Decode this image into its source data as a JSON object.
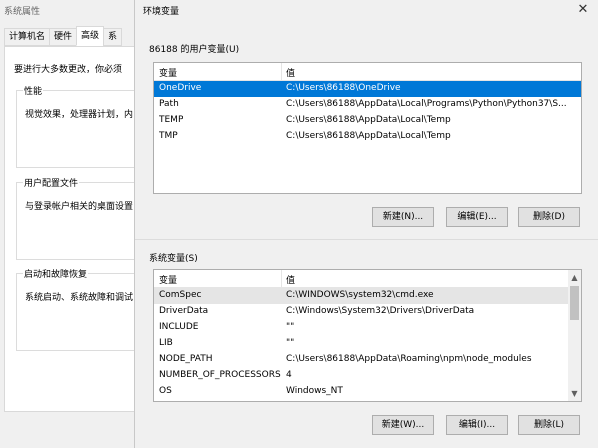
{
  "background_window": {
    "title": "系统属性",
    "tabs": [
      "计算机名",
      "硬件",
      "高级",
      "系"
    ],
    "notice": "要进行大多数更改，你必须",
    "groups": [
      {
        "label": "性能",
        "text": "视觉效果，处理器计划，内"
      },
      {
        "label": "用户配置文件",
        "text": "与登录帐户相关的桌面设置"
      },
      {
        "label": "启动和故障恢复",
        "text": "系统启动、系统故障和调试"
      }
    ]
  },
  "dialog": {
    "title": "环境变量",
    "close_symbol": "✕",
    "user_section_label": "86188 的用户变量(U)",
    "system_section_label": "系统变量(S)",
    "col_variable": "变量",
    "col_value": "值",
    "user_vars": [
      {
        "name": "OneDrive",
        "value": "C:\\Users\\86188\\OneDrive"
      },
      {
        "name": "Path",
        "value": "C:\\Users\\86188\\AppData\\Local\\Programs\\Python\\Python37\\S..."
      },
      {
        "name": "TEMP",
        "value": "C:\\Users\\86188\\AppData\\Local\\Temp"
      },
      {
        "name": "TMP",
        "value": "C:\\Users\\86188\\AppData\\Local\\Temp"
      }
    ],
    "system_vars": [
      {
        "name": "ComSpec",
        "value": "C:\\WINDOWS\\system32\\cmd.exe"
      },
      {
        "name": "DriverData",
        "value": "C:\\Windows\\System32\\Drivers\\DriverData"
      },
      {
        "name": "INCLUDE",
        "value": "\"\""
      },
      {
        "name": "LIB",
        "value": "\"\""
      },
      {
        "name": "NODE_PATH",
        "value": "C:\\Users\\86188\\AppData\\Roaming\\npm\\node_modules"
      },
      {
        "name": "NUMBER_OF_PROCESSORS",
        "value": "4"
      },
      {
        "name": "OS",
        "value": "Windows_NT"
      }
    ],
    "user_buttons": {
      "new": "新建(N)...",
      "edit": "编辑(E)...",
      "delete": "删除(D)"
    },
    "system_buttons": {
      "new": "新建(W)...",
      "edit": "编辑(I)...",
      "delete": "删除(L)"
    },
    "selected_color": "#0078d7"
  }
}
